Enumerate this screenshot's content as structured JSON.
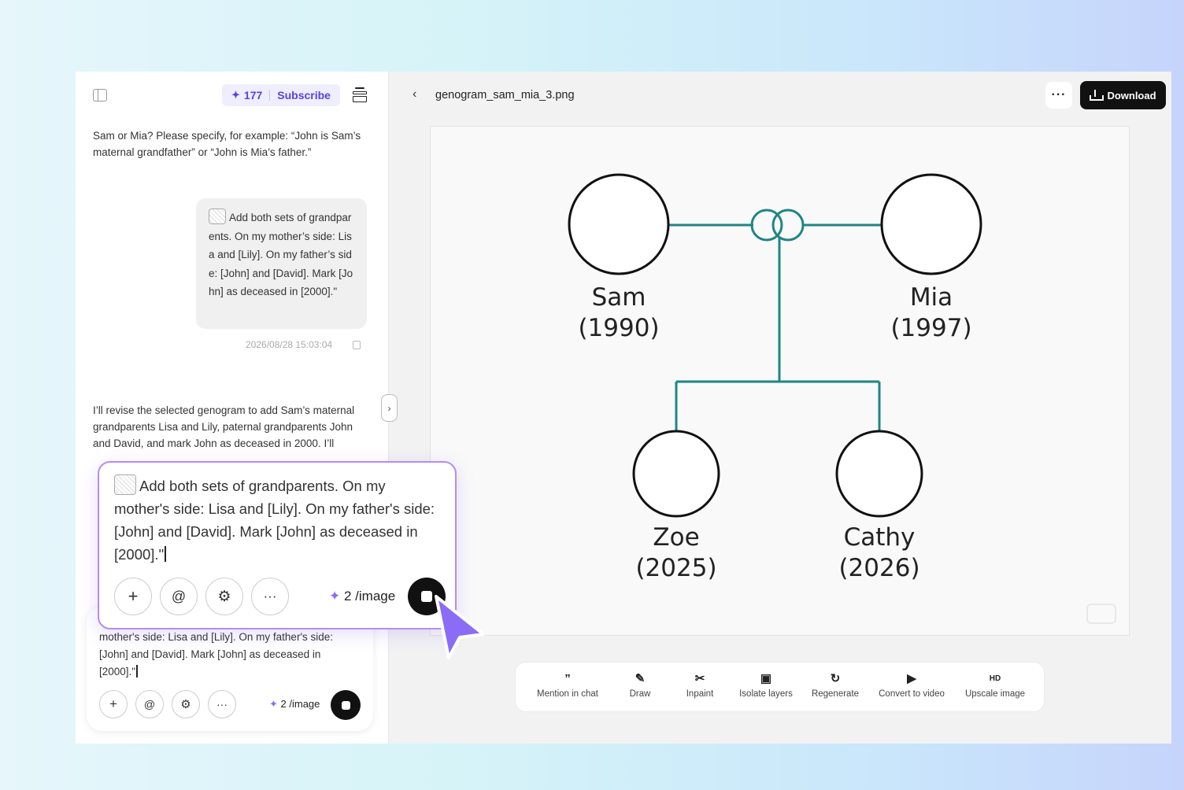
{
  "left_panel": {
    "credits": {
      "amount": "177",
      "subscribe_label": "Subscribe"
    },
    "assistant_question": "Sam or Mia? Please specify, for example: “John is Sam’s maternal grandfather” or “John is Mia’s father.”",
    "user_message": "Add both sets of grandparents. On my mother’s side: Lisa and [Lily]. On my father’s side: [John] and [David]. Mark [John] as deceased in [2000].\"",
    "timestamp": "2026/08/28 15:03:04",
    "assistant_reply": "I’ll revise the selected genogram to add Sam’s maternal grandparents Lisa and Lily, paternal grandparents John and David, and mark John as deceased in 2000. I’ll preserve the existing Sam, Mia,",
    "composer": {
      "text": "mother's side: Lisa and [Lily]. On my father's side: [John] and [David]. Mark [John] as deceased in [2000].\"",
      "cost": "2 /image"
    }
  },
  "zoom_composer": {
    "text": "Add both sets of grandparents. On my mother's side: Lisa and [Lily]. On my father's side: [John] and [David]. Mark [John] as deceased in [2000].\"",
    "cost": "2 /image"
  },
  "main": {
    "filename": "genogram_sam_mia_3.png",
    "download_label": "Download",
    "genogram": {
      "parents": [
        {
          "name": "Sam",
          "year": "(1990)"
        },
        {
          "name": "Mia",
          "year": "(1997)"
        }
      ],
      "children": [
        {
          "name": "Zoe",
          "year": "(2025)"
        },
        {
          "name": "Cathy",
          "year": "(2026)"
        }
      ],
      "line_color": "#1f8585"
    },
    "tools": [
      {
        "icon": "quote-icon",
        "label": "Mention in chat"
      },
      {
        "icon": "brush-icon",
        "label": "Draw"
      },
      {
        "icon": "scissors-icon",
        "label": "Inpaint"
      },
      {
        "icon": "layers-icon",
        "label": "Isolate layers"
      },
      {
        "icon": "refresh-icon",
        "label": "Regenerate"
      },
      {
        "icon": "video-icon",
        "label": "Convert to video"
      },
      {
        "icon": "hd-icon",
        "label": "Upscale image"
      }
    ]
  },
  "colors": {
    "accent": "#5b41e4",
    "highlight_border": "#b58cf7",
    "cursor": "#8b6cf6"
  }
}
